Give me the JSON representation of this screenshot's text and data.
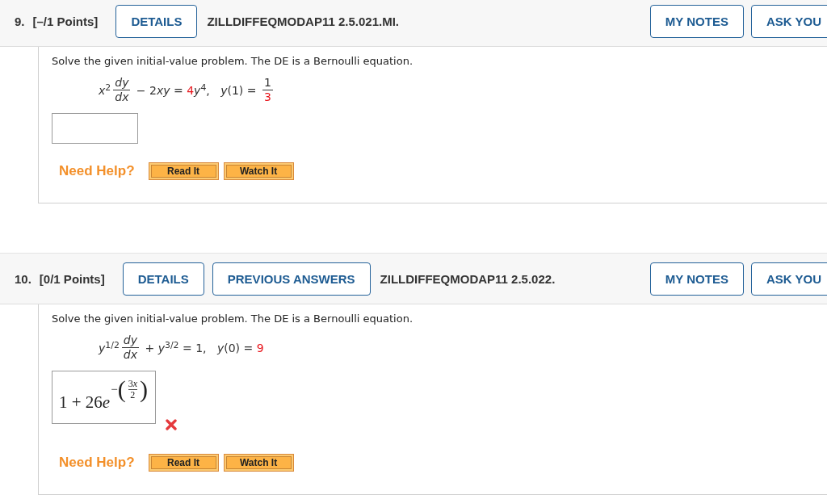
{
  "questions": [
    {
      "number": "9.",
      "points": "[–/1 Points]",
      "buttons": [
        "DETAILS"
      ],
      "code": "ZILLDIFFEQMODAP11 2.5.021.MI.",
      "side_buttons": [
        "MY NOTES",
        "ASK YOU"
      ],
      "prompt": "Solve the given initial-value problem. The DE is a Bernoulli equation.",
      "equation": [
        {
          "kind": "text",
          "text": "*x*$^{2}$",
          "highlight": false
        },
        {
          "kind": "frac",
          "num": {
            "text": "*dy*",
            "highlight": false
          },
          "den": {
            "text": "*dx*",
            "highlight": false
          }
        },
        {
          "kind": "text",
          "text": " − 2",
          "highlight": false
        },
        {
          "kind": "text",
          "text": "*xy* = ",
          "highlight": false
        },
        {
          "kind": "text",
          "text": "4",
          "highlight": true
        },
        {
          "kind": "text",
          "text": "*y*$^{4}$,   *y*(1) = ",
          "highlight": false
        },
        {
          "kind": "frac",
          "num": {
            "text": "1",
            "highlight": false
          },
          "den": {
            "text": "3",
            "highlight": true
          }
        }
      ],
      "help": {
        "label": "Need Help?",
        "buttons": [
          "Read It",
          "Watch It"
        ]
      }
    },
    {
      "number": "10.",
      "points": "[0/1 Points]",
      "buttons": [
        "DETAILS",
        "PREVIOUS ANSWERS"
      ],
      "code": "ZILLDIFFEQMODAP11 2.5.022.",
      "side_buttons": [
        "MY NOTES",
        "ASK YOU"
      ],
      "prompt": "Solve the given initial-value problem. The DE is a Bernoulli equation.",
      "equation": [
        {
          "kind": "text",
          "text": "*y*$^{1/2}$",
          "highlight": false
        },
        {
          "kind": "frac",
          "num": {
            "text": "*dy*",
            "highlight": false
          },
          "den": {
            "text": "*dx*",
            "highlight": false
          }
        },
        {
          "kind": "text",
          "text": " + *y*$^{3/2}$ = 1,   *y*(0) = ",
          "highlight": false
        },
        {
          "kind": "text",
          "text": "9",
          "highlight": true
        }
      ],
      "answer": {
        "base": [
          {
            "kind": "num",
            "text": "1 + 26"
          },
          {
            "kind": "var",
            "text": "e"
          }
        ],
        "sign": "−",
        "open": "(",
        "num": [
          {
            "kind": "num",
            "text": "3"
          },
          {
            "kind": "var",
            "text": "x"
          }
        ],
        "den": [
          {
            "kind": "num",
            "text": "2"
          }
        ],
        "close": ")",
        "correct": false
      },
      "help": {
        "label": "Need Help?",
        "buttons": [
          "Read It",
          "Watch It"
        ]
      }
    }
  ]
}
